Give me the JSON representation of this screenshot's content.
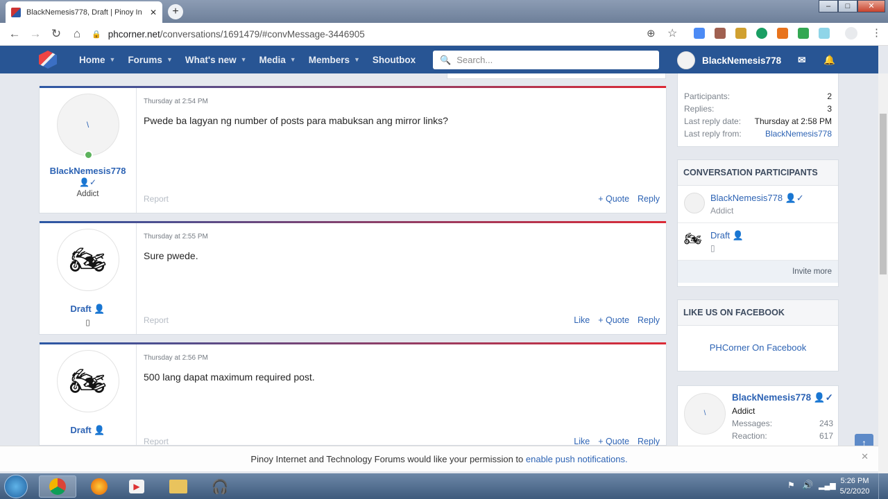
{
  "browser": {
    "tab_title": "BlackNemesis778, Draft | Pinoy In",
    "url_domain": "phcorner.net",
    "url_path": "/conversations/1691479/#convMessage-3446905",
    "window_buttons": [
      "–",
      "□",
      "✕"
    ]
  },
  "nav": {
    "items": [
      {
        "label": "Home",
        "dropdown": true
      },
      {
        "label": "Forums",
        "dropdown": true
      },
      {
        "label": "What's new",
        "dropdown": true
      },
      {
        "label": "Media",
        "dropdown": true
      },
      {
        "label": "Members",
        "dropdown": true
      },
      {
        "label": "Shoutbox",
        "dropdown": false
      }
    ],
    "search_placeholder": "Search...",
    "username": "BlackNemesis778"
  },
  "messages": [
    {
      "user": "BlackNemesis778",
      "title": "Addict",
      "time": "Thursday at 2:54 PM",
      "text": "Pwede ba lagyan ng number of posts para mabuksan ang mirror links?",
      "actions": [
        "+ Quote",
        "Reply"
      ],
      "report": "Report"
    },
    {
      "user": "Draft",
      "title": "▯",
      "time": "Thursday at 2:55 PM",
      "text": "Sure pwede.",
      "actions": [
        "Like",
        "+ Quote",
        "Reply"
      ],
      "report": "Report"
    },
    {
      "user": "Draft",
      "title": "▯",
      "time": "Thursday at 2:56 PM",
      "text": "500 lang dapat maximum required post.",
      "actions": [
        "Like",
        "+ Quote",
        "Reply"
      ],
      "report": "Report"
    }
  ],
  "sidebar": {
    "stats": [
      {
        "label": "Participants:",
        "value": "2"
      },
      {
        "label": "Replies:",
        "value": "3"
      },
      {
        "label": "Last reply date:",
        "value": "Thursday at 2:58 PM"
      },
      {
        "label": "Last reply from:",
        "value": "BlackNemesis778"
      }
    ],
    "participants_header": "CONVERSATION PARTICIPANTS",
    "participants": [
      {
        "name": "BlackNemesis778",
        "title": "Addict"
      },
      {
        "name": "Draft",
        "title": "▯"
      }
    ],
    "invite": "Invite more",
    "facebook_header": "LIKE US ON FACEBOOK",
    "facebook_link": "PHCorner On Facebook",
    "profile": {
      "name": "BlackNemesis778",
      "title": "Addict",
      "messages_label": "Messages:",
      "messages": "243",
      "reaction_label": "Reaction:",
      "reaction": "617"
    }
  },
  "notice": {
    "text": "Pinoy Internet and Technology Forums would like your permission to ",
    "link": "enable push notifications."
  },
  "taskbar": {
    "time": "5:26 PM",
    "date": "5/2/2020"
  },
  "colors": {
    "nav": "#285594",
    "link": "#2d63b4",
    "accent_red": "#dc2a36"
  }
}
